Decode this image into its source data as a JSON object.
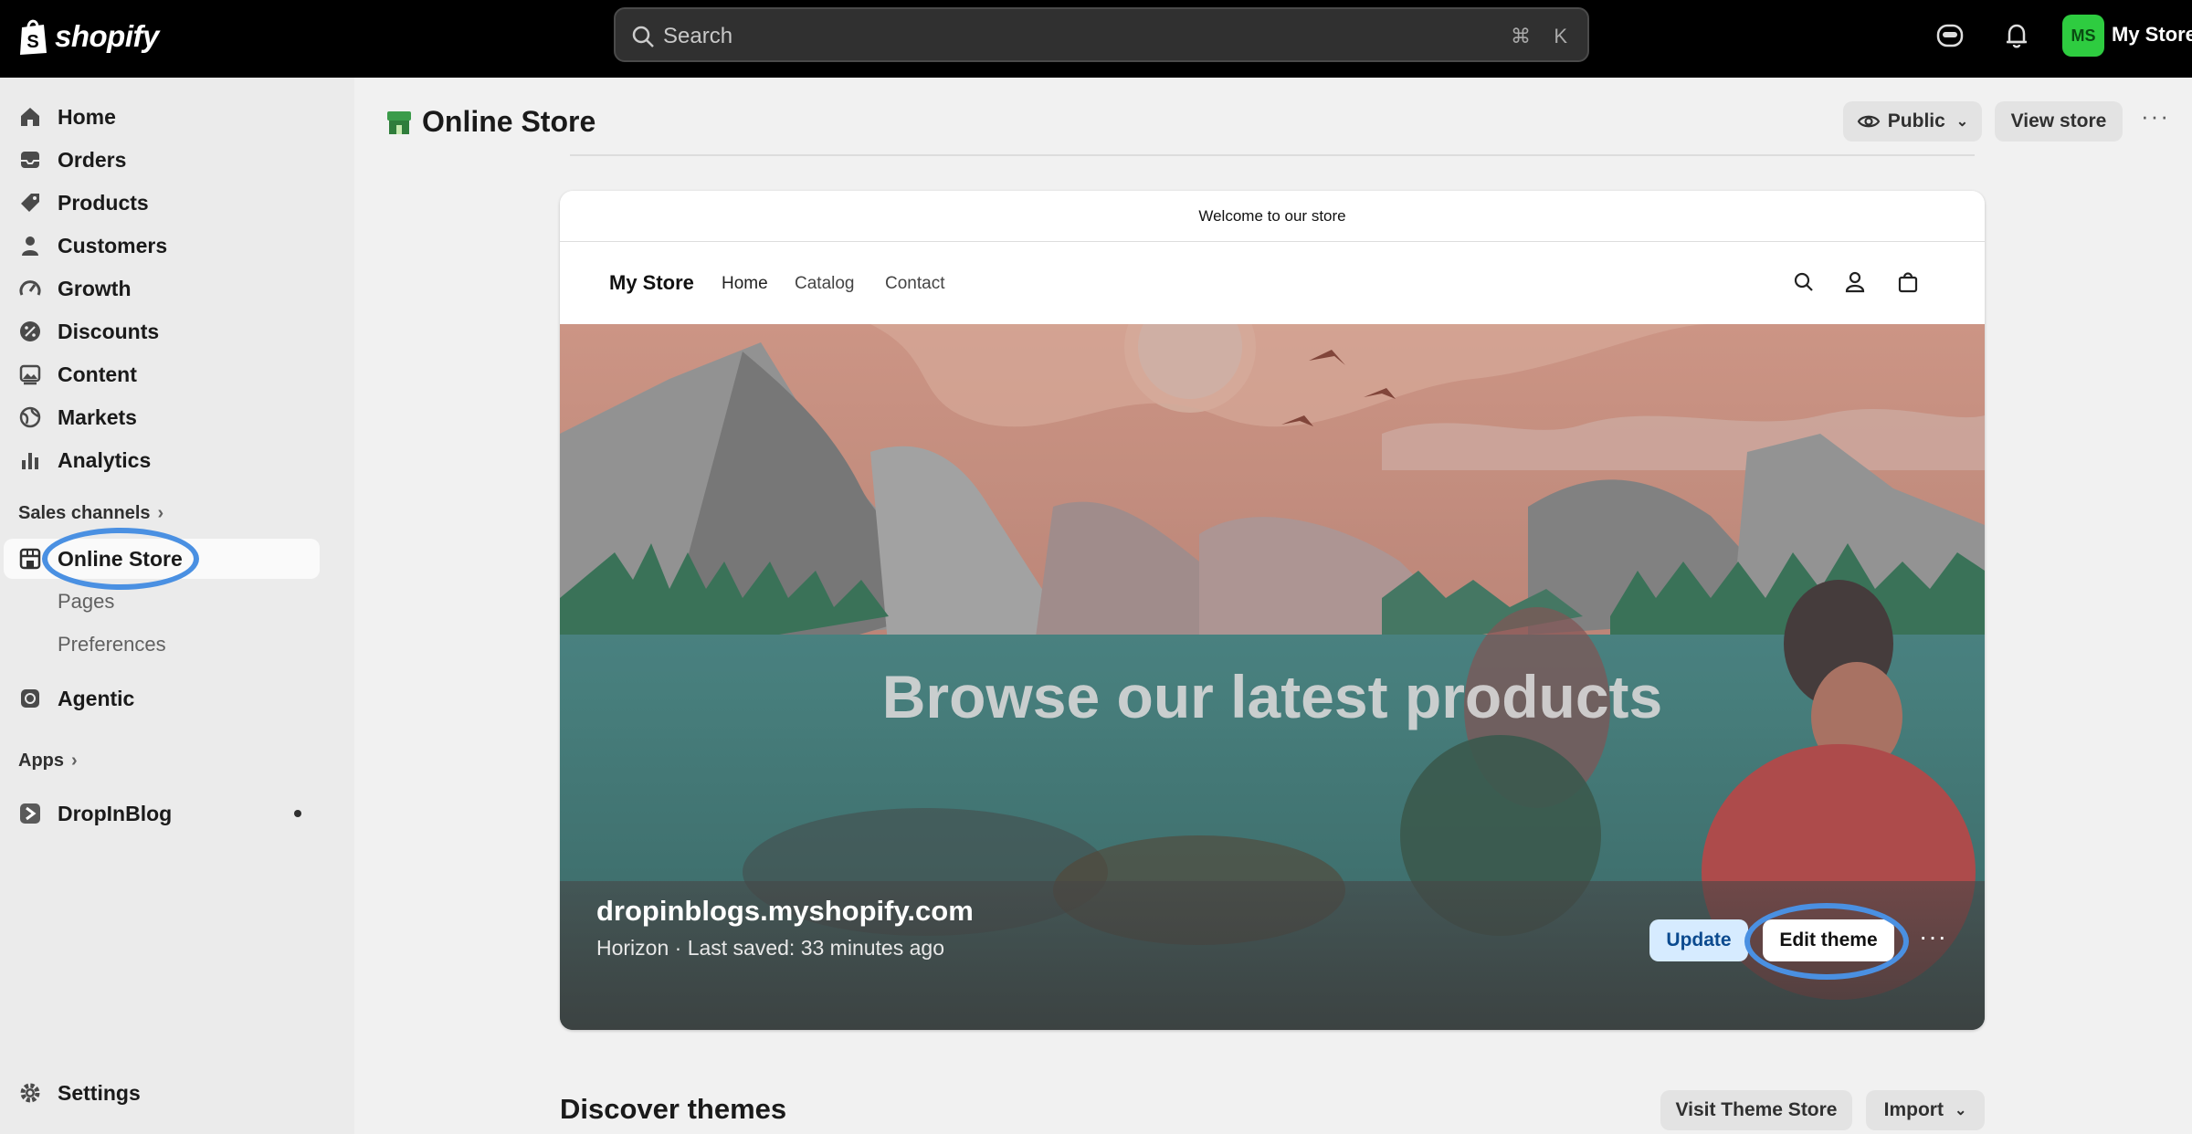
{
  "topbar": {
    "brand": "shopify",
    "search_placeholder": "Search",
    "shortcut_cmd": "⌘",
    "shortcut_key": "K",
    "avatar_initials": "MS",
    "store_name": "My Store"
  },
  "sidebar": {
    "items": [
      {
        "label": "Home",
        "icon": "home-icon"
      },
      {
        "label": "Orders",
        "icon": "inbox-icon"
      },
      {
        "label": "Products",
        "icon": "tag-icon"
      },
      {
        "label": "Customers",
        "icon": "person-icon"
      },
      {
        "label": "Growth",
        "icon": "gauge-icon"
      },
      {
        "label": "Discounts",
        "icon": "discount-icon"
      },
      {
        "label": "Content",
        "icon": "image-icon"
      },
      {
        "label": "Markets",
        "icon": "globe-icon"
      },
      {
        "label": "Analytics",
        "icon": "bar-chart-icon"
      }
    ],
    "sales_channels_label": "Sales channels",
    "online_store_label": "Online Store",
    "sub_items": [
      "Pages",
      "Preferences"
    ],
    "agentic_label": "Agentic",
    "apps_label": "Apps",
    "dropinblog_label": "DropInBlog",
    "settings_label": "Settings"
  },
  "header": {
    "title": "Online Store",
    "visibility_label": "Public",
    "view_store_label": "View store"
  },
  "preview": {
    "announcement": "Welcome to our store",
    "brand": "My Store",
    "nav_links": [
      "Home",
      "Catalog",
      "Contact"
    ],
    "hero_title": "Browse our latest products",
    "domain": "dropinblogs.myshopify.com",
    "meta": "Horizon · Last saved: 33 minutes ago",
    "update_label": "Update",
    "edit_theme_label": "Edit theme"
  },
  "discover": {
    "title": "Discover themes",
    "visit_label": "Visit Theme Store",
    "import_label": "Import"
  },
  "colors": {
    "accent_highlight": "#4a90e2",
    "avatar": "#2ecc40",
    "topbar": "#000000"
  }
}
